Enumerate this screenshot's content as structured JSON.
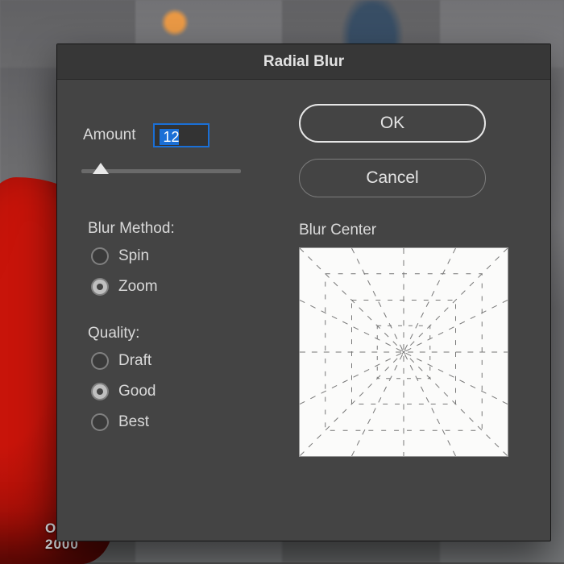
{
  "dialog": {
    "title": "Radial Blur",
    "amount": {
      "label": "Amount",
      "value": "12",
      "min": 0,
      "max": 100
    },
    "blur_method": {
      "label": "Blur Method:",
      "options": [
        {
          "label": "Spin",
          "checked": false
        },
        {
          "label": "Zoom",
          "checked": true
        }
      ]
    },
    "quality": {
      "label": "Quality:",
      "options": [
        {
          "label": "Draft",
          "checked": false
        },
        {
          "label": "Good",
          "checked": true
        },
        {
          "label": "Best",
          "checked": false
        }
      ]
    },
    "blur_center_label": "Blur Center",
    "buttons": {
      "ok": "OK",
      "cancel": "Cancel"
    }
  }
}
